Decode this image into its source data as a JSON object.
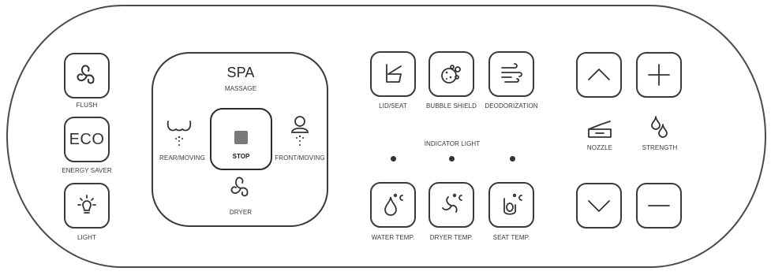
{
  "left_column": {
    "flush_label": "FLUSH",
    "eco_label": "ECO",
    "energy_saver_label": "ENERGY SAVER",
    "light_label": "LIGHT"
  },
  "spa": {
    "title": "SPA",
    "subtitle": "MASSAGE",
    "rear_label": "REAR/MOVING",
    "front_label": "FRONT/MOVING",
    "stop_label": "STOP",
    "dryer_label": "DRYER"
  },
  "functions": {
    "lid_seat_label": "LID/SEAT",
    "bubble_shield_label": "BUBBLE SHIELD",
    "deodorization_label": "DEODORIZATION"
  },
  "indicator": {
    "label": "INDICATOR LIGHT"
  },
  "temps": {
    "water_label": "WATER TEMP.",
    "dryer_label": "DRYER TEMP.",
    "seat_label": "SEAT TEMP."
  },
  "adjust": {
    "nozzle_label": "NOZZLE",
    "strength_label": "STRENGTH"
  },
  "icons": {
    "flush": "flush-swirl-icon",
    "light": "light-bulb-icon",
    "rear": "rear-wash-icon",
    "front": "front-wash-icon",
    "stop": "stop-square-icon",
    "dryer": "dryer-fan-icon",
    "lid_seat": "lid-seat-icon",
    "bubble_shield": "bubble-icon",
    "deodorization": "deodorization-icon",
    "water_temp": "water-drop-celsius-icon",
    "dryer_temp": "wind-celsius-icon",
    "seat_temp": "seat-celsius-icon",
    "up": "chevron-up-icon",
    "down": "chevron-down-icon",
    "plus": "plus-icon",
    "minus": "minus-icon",
    "nozzle": "nozzle-icon",
    "strength": "water-drops-icon"
  }
}
